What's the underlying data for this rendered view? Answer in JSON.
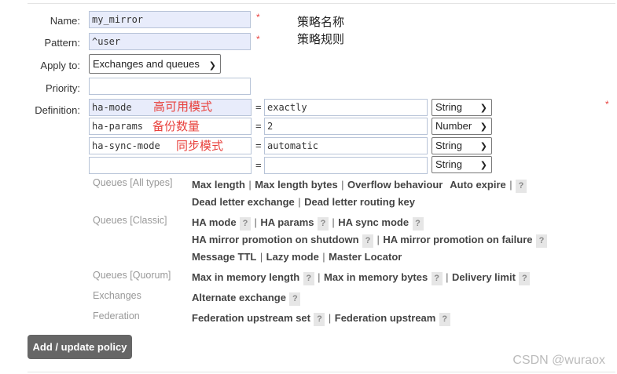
{
  "form": {
    "name_label": "Name:",
    "name_value": "my_mirror",
    "pattern_label": "Pattern:",
    "pattern_value": "^user",
    "apply_label": "Apply to:",
    "apply_value": "Exchanges and queues",
    "priority_label": "Priority:",
    "priority_value": "",
    "definition_label": "Definition:",
    "required_mark": "*"
  },
  "annotations": {
    "name_note": "策略名称",
    "pattern_note": "策略规则",
    "ha_mode_note": "高可用模式",
    "ha_params_note": "备份数量",
    "ha_sync_note": "同步模式"
  },
  "definition_rows": [
    {
      "key": "ha-mode",
      "eq": "=",
      "value": "exactly",
      "type": "String"
    },
    {
      "key": "ha-params",
      "eq": "=",
      "value": "2",
      "type": "Number"
    },
    {
      "key": "ha-sync-mode",
      "eq": "=",
      "value": "automatic",
      "type": "String"
    },
    {
      "key": "",
      "eq": "=",
      "value": "",
      "type": "String"
    }
  ],
  "helpers": {
    "all_types_label": "Queues [All types]",
    "all_types": [
      "Max length",
      "Max length bytes",
      "Overflow behaviour",
      "Auto expire",
      "Dead letter exchange",
      "Dead letter routing key"
    ],
    "classic_label": "Queues [Classic]",
    "classic": [
      "HA mode",
      "HA params",
      "HA sync mode",
      "HA mirror promotion on shutdown",
      "HA mirror promotion on failure",
      "Message TTL",
      "Lazy mode",
      "Master Locator"
    ],
    "quorum_label": "Queues [Quorum]",
    "quorum": [
      "Max in memory length",
      "Max in memory bytes",
      "Delivery limit"
    ],
    "exchanges_label": "Exchanges",
    "exchanges": [
      "Alternate exchange"
    ],
    "federation_label": "Federation",
    "federation": [
      "Federation upstream set",
      "Federation upstream"
    ],
    "sep": "|",
    "help": "?"
  },
  "submit_label": "Add / update policy",
  "watermark": "CSDN @wuraox"
}
